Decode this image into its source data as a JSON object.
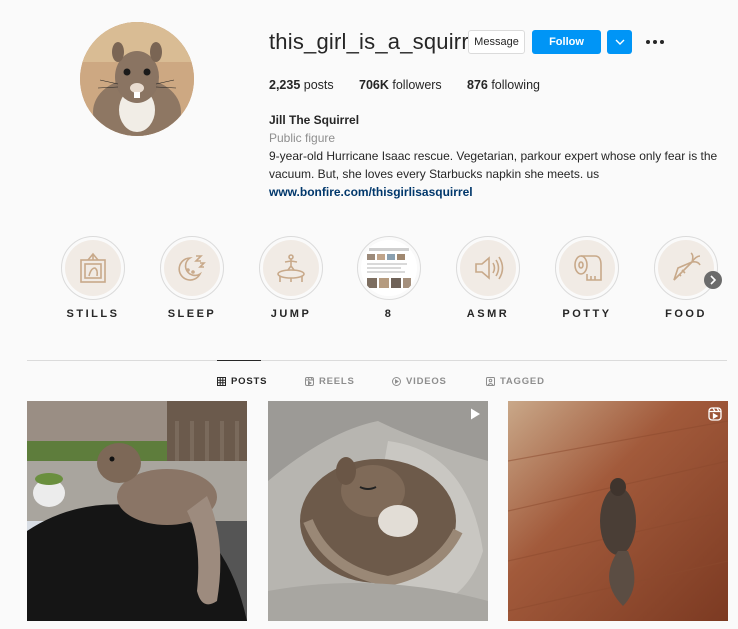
{
  "profile": {
    "username": "this_girl_is_a_squirrel",
    "message_label": "Message",
    "follow_label": "Follow",
    "stats": {
      "posts_count": "2,235",
      "posts_label": " posts",
      "followers_count": "706K",
      "followers_label": " followers",
      "following_count": "876",
      "following_label": " following"
    },
    "bio": {
      "name": "Jill The Squirrel",
      "category": "Public figure",
      "text": "9-year-old Hurricane Isaac rescue. Vegetarian, parkour expert whose only fear is the vacuum. But, she loves every Starbucks napkin she meets. us",
      "link": "www.bonfire.com/thisgirlisasquirrel"
    }
  },
  "highlights": [
    {
      "label": "STILLS",
      "icon": "picture-frame-icon"
    },
    {
      "label": "SLEEP",
      "icon": "moon-zzz-icon"
    },
    {
      "label": "JUMP",
      "icon": "trampoline-icon"
    },
    {
      "label": "8",
      "icon": "photo-collage-thumbnail"
    },
    {
      "label": "ASMR",
      "icon": "speaker-icon"
    },
    {
      "label": "POTTY",
      "icon": "toilet-paper-icon"
    },
    {
      "label": "FOOD",
      "icon": "carrot-icon"
    }
  ],
  "tabs": [
    {
      "label": "POSTS",
      "icon": "grid-icon",
      "active": true
    },
    {
      "label": "REELS",
      "icon": "reels-icon",
      "active": false
    },
    {
      "label": "VIDEOS",
      "icon": "play-circle-icon",
      "active": false
    },
    {
      "label": "TAGGED",
      "icon": "tag-icon",
      "active": false
    }
  ],
  "posts": [
    {
      "type": "photo",
      "description_icon": "squirrel-on-shoulder-photo"
    },
    {
      "type": "video",
      "badge_icon": "play-icon"
    },
    {
      "type": "video",
      "badge_icon": "reels-icon"
    }
  ],
  "colors": {
    "accent": "#0095f6",
    "text": "#262626",
    "muted": "#8e8e8e",
    "link": "#00376b",
    "border": "#dbdbdb",
    "highlight_bg": "#f1ebe5",
    "highlight_icon": "#c8a98a"
  }
}
